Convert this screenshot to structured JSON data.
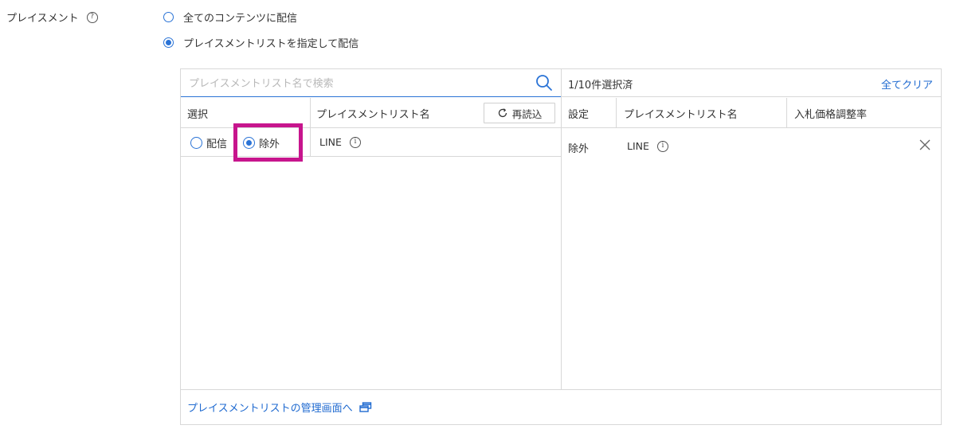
{
  "section": {
    "label": "プレイスメント",
    "help_icon_glyph": "?"
  },
  "options": [
    {
      "label": "全てのコンテンツに配信",
      "checked": false
    },
    {
      "label": "プレイスメントリストを指定して配信",
      "checked": true
    }
  ],
  "left": {
    "search_placeholder": "プレイスメントリスト名で検索",
    "headers": {
      "select": "選択",
      "name": "プレイスメントリスト名"
    },
    "reload_label": "再読込",
    "rows": [
      {
        "deliver_label": "配信",
        "exclude_label": "除外",
        "selected": "exclude",
        "name": "LINE",
        "info_glyph": "i"
      }
    ]
  },
  "right": {
    "count_text": "1/10件選択済",
    "clear_all_label": "全てクリア",
    "headers": {
      "setting": "設定",
      "name": "プレイスメントリスト名",
      "bid_rate": "入札価格調整率"
    },
    "rows": [
      {
        "setting": "除外",
        "name": "LINE",
        "info_glyph": "i",
        "bid_rate": ""
      }
    ]
  },
  "footer": {
    "link_label": "プレイスメントリストの管理画面へ"
  },
  "colors": {
    "accent": "#2a73d6",
    "link": "#1f6ad0",
    "highlight": "#c7158d",
    "border": "#d8d8d8"
  },
  "icons": {
    "search": "search-icon",
    "reload": "reload-icon",
    "info": "info-icon",
    "close": "close-icon",
    "external": "external-window-icon",
    "help": "help-icon"
  }
}
